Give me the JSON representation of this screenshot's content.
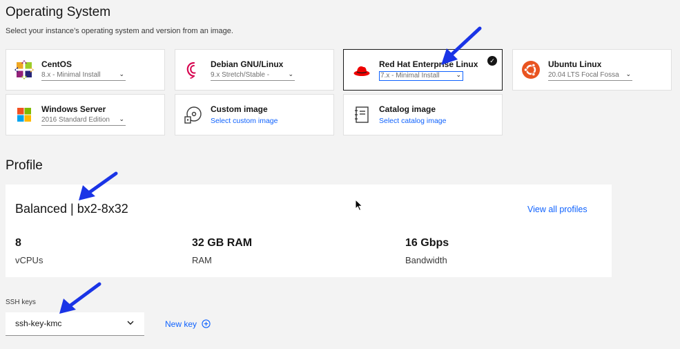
{
  "os": {
    "title": "Operating System",
    "subtitle": "Select your instance’s operating system and version from an image.",
    "tiles": [
      {
        "name": "CentOS",
        "version": "8.x - Minimal Install"
      },
      {
        "name": "Debian GNU/Linux",
        "version": "9.x Stretch/Stable -"
      },
      {
        "name": "Red Hat Enterprise Linux",
        "version": "7.x - Minimal Install",
        "selected": true
      },
      {
        "name": "Ubuntu Linux",
        "version": "20.04 LTS Focal Fossa"
      },
      {
        "name": "Windows Server",
        "version": "2016 Standard Edition"
      },
      {
        "name": "Custom image",
        "link": "Select custom image"
      },
      {
        "name": "Catalog image",
        "link": "Select catalog image"
      }
    ]
  },
  "profile": {
    "title": "Profile",
    "name": "Balanced | bx2-8x32",
    "view_all": "View all profiles",
    "stats": [
      {
        "value": "8",
        "label": "vCPUs"
      },
      {
        "value": "32 GB RAM",
        "label": "RAM"
      },
      {
        "value": "16 Gbps",
        "label": "Bandwidth"
      }
    ]
  },
  "ssh": {
    "label": "SSH keys",
    "value": "ssh-key-kmc",
    "new_key": "New key"
  },
  "colors": {
    "link": "#0f62fe",
    "annotation_arrow": "#1a34e6",
    "redhat": "#ee0000",
    "ubuntu": "#e95420"
  }
}
